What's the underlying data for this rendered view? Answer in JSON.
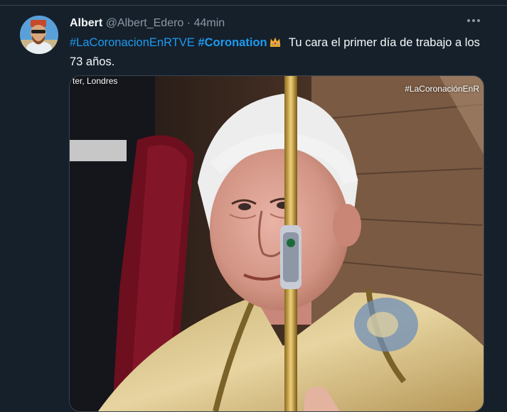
{
  "tweet": {
    "author_name": "Albert",
    "author_handle": "@Albert_Edero",
    "separator": "·",
    "time": "44min",
    "more_icon": "more-horizontal-icon",
    "text": {
      "hashtag1": "#LaCoronacionEnRTVE",
      "hashtag2": "#Coronation",
      "crown_icon": "crown-emoji-icon",
      "body": "Tu cara el primer día de trabajo a los 73 años."
    }
  },
  "media": {
    "overlay_location": "ter, Londres",
    "overlay_hashtag": "#LaCoronaciónEnR"
  }
}
